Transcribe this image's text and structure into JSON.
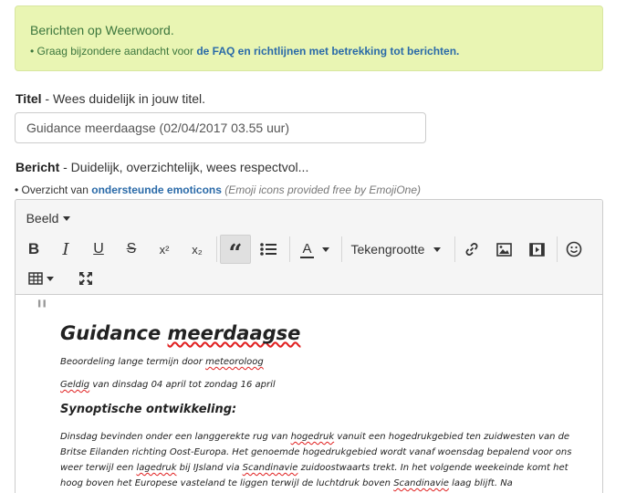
{
  "notice": {
    "title": "Berichten op Weerwoord.",
    "line_prefix": "• Graag bijzondere aandacht voor ",
    "line_link": "de FAQ en richtlijnen met betrekking tot berichten."
  },
  "title_field": {
    "label_bold": "Titel",
    "label_rest": " - Wees duidelijk in jouw titel.",
    "value": "Guidance meerdaagse (02/04/2017 03.55 uur)"
  },
  "message_field": {
    "label_bold": "Bericht",
    "label_rest": " - Duidelijk, overzichtelijk, wees respectvol..."
  },
  "emoticons": {
    "prefix": "• Overzicht van ",
    "link": "ondersteunde emoticons",
    "credit": "(Emoji icons provided free by EmojiOne)"
  },
  "toolbar": {
    "style_menu": "Beeld",
    "bold": "B",
    "italic": "I",
    "underline": "U",
    "strike": "S",
    "superscript": "x²",
    "subscript": "x₂",
    "blockquote": "“",
    "font_color": "A",
    "font_size_label": "Tekengrootte"
  },
  "document": {
    "quote_glyph": "\"",
    "heading_pre": "Guidance ",
    "heading_sq": "meerdaagse",
    "line1_pre": "Beoordeling lange termijn door ",
    "line1_sq": "meteoroloog",
    "line2_sq": "Geldig",
    "line2_post": " van dinsdag 04 april tot zondag 16 april",
    "subheading": "Synoptische ontwikkeling:",
    "p_a": "Dinsdag bevinden onder een langgerekte rug van ",
    "p_b": "hogedruk",
    "p_c": " vanuit een hogedrukgebied ten zuidwesten van de Britse Eilanden richting Oost-Europa. Het genoemde hogedrukgebied wordt vanaf woensdag bepalend voor ons weer terwijl een ",
    "p_d": "lagedruk",
    "p_e": " bij IJsland via ",
    "p_f": "Scandinavie",
    "p_g": " zuidoostwaarts trekt. In het volgende weekeinde komt het hoog boven het Europese vasteland te liggen terwijl de luchtdruk boven ",
    "p_h": "Scandinavie",
    "p_i": " laag blijft. Na"
  }
}
